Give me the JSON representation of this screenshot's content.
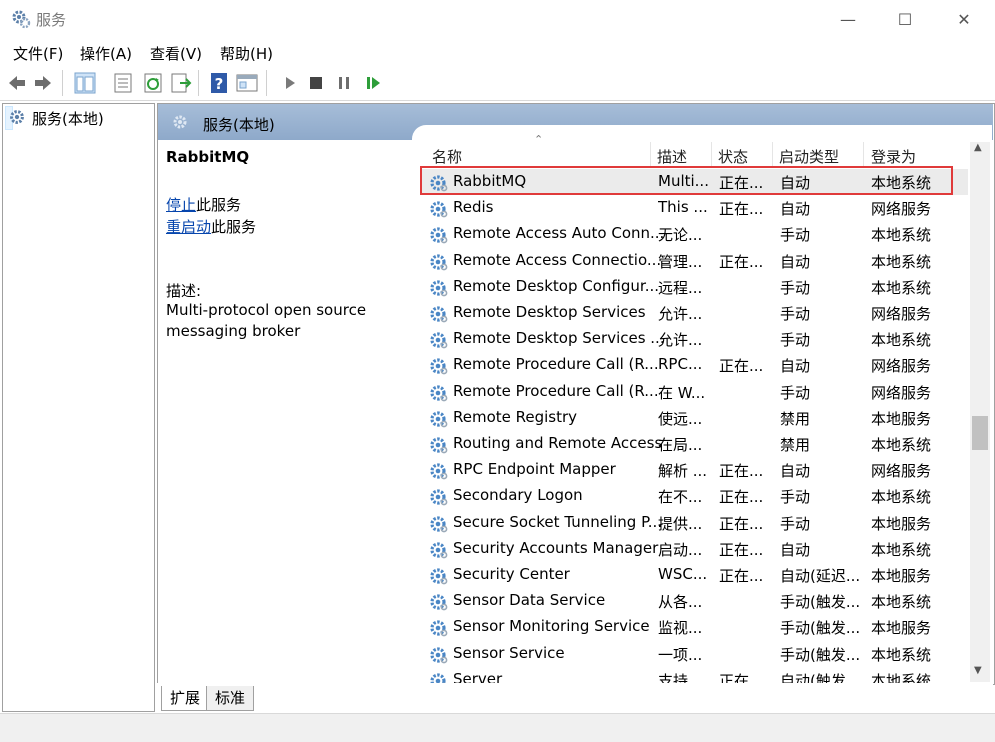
{
  "window": {
    "title": "服务",
    "controls": [
      "minimize",
      "maximize",
      "close"
    ]
  },
  "menu": [
    "文件(F)",
    "操作(A)",
    "查看(V)",
    "帮助(H)"
  ],
  "toolbar": [
    "back-icon",
    "forward-icon",
    "show-tree-icon",
    "properties-icon",
    "refresh-icon",
    "export-icon",
    "help-icon",
    "console-icon",
    "play-icon",
    "stop-icon",
    "pause-icon",
    "resume-icon"
  ],
  "tree": {
    "item": "服务(本地)"
  },
  "right_header": "服务(本地)",
  "detail": {
    "title": "RabbitMQ",
    "stop_link": "停止",
    "stop_suffix": "此服务",
    "restart_link": "重启动",
    "restart_suffix": "此服务",
    "desc_label": "描述:",
    "desc_line1": "Multi-protocol open source",
    "desc_line2": "messaging broker"
  },
  "columns": [
    "名称",
    "描述",
    "状态",
    "启动类型",
    "登录为"
  ],
  "rows": [
    [
      "RabbitMQ",
      "Multi...",
      "正在...",
      "自动",
      "本地系统"
    ],
    [
      "Redis",
      "This ...",
      "正在...",
      "自动",
      "网络服务"
    ],
    [
      "Remote Access Auto Conn...",
      "无论...",
      "",
      "手动",
      "本地系统"
    ],
    [
      "Remote Access Connectio...",
      "管理...",
      "正在...",
      "自动",
      "本地系统"
    ],
    [
      "Remote Desktop Configur...",
      "远程...",
      "",
      "手动",
      "本地系统"
    ],
    [
      "Remote Desktop Services",
      "允许...",
      "",
      "手动",
      "网络服务"
    ],
    [
      "Remote Desktop Services ...",
      "允许...",
      "",
      "手动",
      "本地系统"
    ],
    [
      "Remote Procedure Call (R...",
      "RPC...",
      "正在...",
      "自动",
      "网络服务"
    ],
    [
      "Remote Procedure Call (R...",
      "在 W...",
      "",
      "手动",
      "网络服务"
    ],
    [
      "Remote Registry",
      "使远...",
      "",
      "禁用",
      "本地服务"
    ],
    [
      "Routing and Remote Access",
      "在局...",
      "",
      "禁用",
      "本地系统"
    ],
    [
      "RPC Endpoint Mapper",
      "解析 ...",
      "正在...",
      "自动",
      "网络服务"
    ],
    [
      "Secondary Logon",
      "在不...",
      "正在...",
      "手动",
      "本地系统"
    ],
    [
      "Secure Socket Tunneling P...",
      "提供...",
      "正在...",
      "手动",
      "本地服务"
    ],
    [
      "Security Accounts Manager",
      "启动...",
      "正在...",
      "自动",
      "本地系统"
    ],
    [
      "Security Center",
      "WSC...",
      "正在...",
      "自动(延迟...",
      "本地服务"
    ],
    [
      "Sensor Data Service",
      "从各...",
      "",
      "手动(触发...",
      "本地系统"
    ],
    [
      "Sensor Monitoring Service",
      "监视...",
      "",
      "手动(触发...",
      "本地服务"
    ],
    [
      "Sensor Service",
      "一项...",
      "",
      "手动(触发...",
      "本地系统"
    ],
    [
      "Server",
      "支持...",
      "正在...",
      "自动(触发...",
      "本地系统"
    ]
  ],
  "tabs": [
    "扩展",
    "标准"
  ],
  "colors": {
    "header_bg": "#9fb7d4",
    "highlight": "#e03a3a",
    "link": "#0645ad",
    "gear": "#4a86c5"
  }
}
